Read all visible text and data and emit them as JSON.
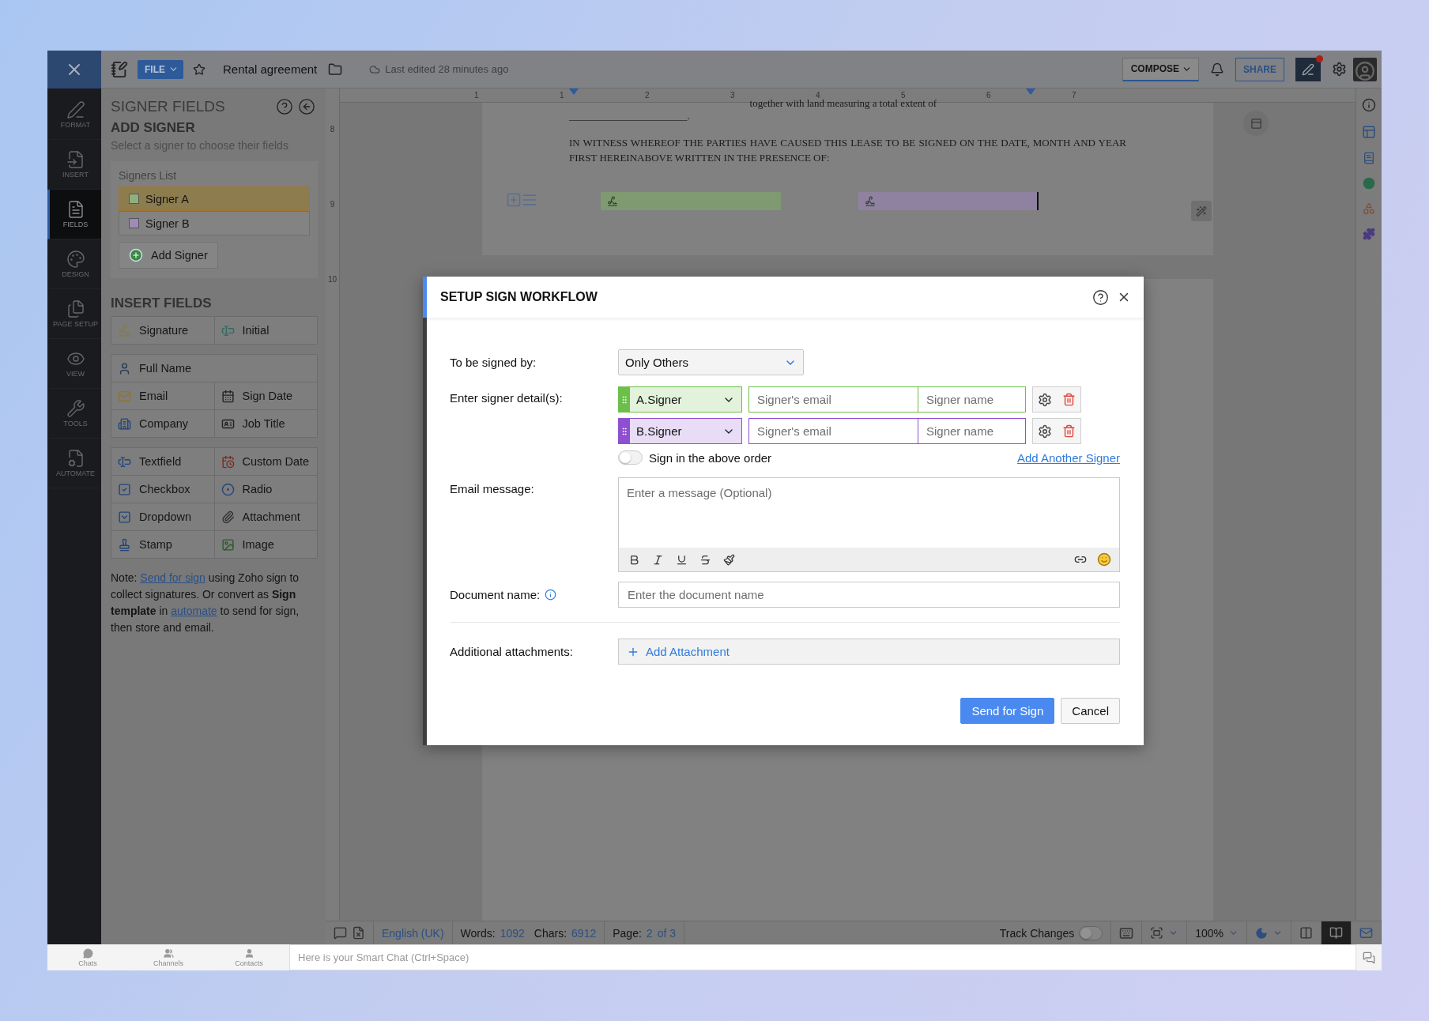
{
  "app_bar": {
    "file_menu": "FILE",
    "document_title": "Rental agreement",
    "last_edited": "Last edited 28 minutes ago",
    "compose": "COMPOSE",
    "share": "SHARE",
    "notification_dot": true
  },
  "nav_rail": [
    {
      "label": "FORMAT",
      "selected": false
    },
    {
      "label": "INSERT",
      "selected": false
    },
    {
      "label": "FIELDS",
      "selected": true
    },
    {
      "label": "DESIGN",
      "selected": false
    },
    {
      "label": "PAGE SETUP",
      "selected": false
    },
    {
      "label": "VIEW",
      "selected": false
    },
    {
      "label": "TOOLS",
      "selected": false
    },
    {
      "label": "AUTOMATE",
      "selected": false
    }
  ],
  "signer_panel": {
    "title": "SIGNER FIELDS",
    "heading": "ADD SIGNER",
    "hint": "Select a signer to choose their fields",
    "signers_list_label": "Signers List",
    "signers": [
      {
        "name": "Signer A",
        "color": "#8fb07d",
        "selected": true
      },
      {
        "name": "Signer B",
        "color": "#a08ab8",
        "selected": false
      }
    ],
    "add_signer": "Add Signer",
    "insert_fields_heading": "INSERT FIELDS",
    "field_groups": [
      [
        {
          "label": "Signature",
          "wide": false
        },
        {
          "label": "Initial",
          "wide": false
        }
      ],
      [
        {
          "label": "Full Name",
          "wide": true
        },
        {
          "label": "Email",
          "wide": false
        },
        {
          "label": "Sign Date",
          "wide": false
        },
        {
          "label": "Company",
          "wide": false
        },
        {
          "label": "Job Title",
          "wide": false
        }
      ],
      [
        {
          "label": "Textfield",
          "wide": false
        },
        {
          "label": "Custom Date",
          "wide": false
        },
        {
          "label": "Checkbox",
          "wide": false
        },
        {
          "label": "Radio",
          "wide": false
        },
        {
          "label": "Dropdown",
          "wide": false
        },
        {
          "label": "Attachment",
          "wide": false
        },
        {
          "label": "Stamp",
          "wide": false
        },
        {
          "label": "Image",
          "wide": false
        }
      ]
    ],
    "note": [
      {
        "kind": "plain",
        "text": "Note: "
      },
      {
        "kind": "link",
        "text": "Send for sign"
      },
      {
        "kind": "plain",
        "text": " using Zoho sign to collect signatures. Or convert as "
      },
      {
        "kind": "bold",
        "text": "Sign template"
      },
      {
        "kind": "plain",
        "text": " in "
      },
      {
        "kind": "link",
        "text": "automate"
      },
      {
        "kind": "plain",
        "text": " to send for sign, then store and email."
      }
    ]
  },
  "ruler": {
    "horizontal": [
      "1",
      "1",
      "2",
      "3",
      "4",
      "5",
      "6",
      "7"
    ],
    "vertical": [
      "8",
      "9",
      "10"
    ]
  },
  "document": {
    "cut_line": "together with land measuring a total extent of",
    "blank_line": "_______________________.",
    "paragraph": "IN WITNESS WHEREOF THE PARTIES HAVE CAUSED THIS LEASE TO BE SIGNED ON THE DATE, MONTH AND YEAR FIRST HEREINABOVE WRITTEN IN THE PRESENCE OF:",
    "signature_fields": [
      {
        "color": "#7f9a70"
      },
      {
        "color": "#8f82a0"
      }
    ]
  },
  "dialog": {
    "title": "SETUP SIGN WORKFLOW",
    "signed_by": {
      "label": "To be signed by:",
      "value": "Only Others"
    },
    "signer_details": {
      "label": "Enter signer detail(s):",
      "signers": [
        {
          "role": "A.Signer",
          "color": "#6cbf4a",
          "email_placeholder": "Signer's email",
          "name_placeholder": "Signer name"
        },
        {
          "role": "B.Signer",
          "color": "#8e4fd0",
          "email_placeholder": "Signer's email",
          "name_placeholder": "Signer name"
        }
      ]
    },
    "sign_in_order": {
      "label": "Sign in the above order",
      "on": false
    },
    "add_another_signer": "Add Another Signer",
    "email_message": {
      "label": "Email message:",
      "placeholder": "Enter a message (Optional)"
    },
    "document_name": {
      "label": "Document name:",
      "placeholder": "Enter the document name"
    },
    "attachments": {
      "label": "Additional attachments:",
      "button": "Add Attachment"
    },
    "buttons": [
      {
        "label": "Send for Sign",
        "kind": "primary"
      },
      {
        "label": "Cancel",
        "kind": "secondary"
      }
    ]
  },
  "status_bar": {
    "language": "English (UK)",
    "words_label": "Words:",
    "words": "1092",
    "chars_label": "Chars:",
    "chars": "6912",
    "page_label": "Page:",
    "page": "2",
    "page_total": "of 3",
    "track_changes": {
      "label": "Track Changes",
      "on": false
    },
    "zoom": "100%"
  },
  "chat_bar": {
    "tabs": [
      "Chats",
      "Channels",
      "Contacts"
    ],
    "placeholder": "Here is your Smart Chat (Ctrl+Space)"
  }
}
